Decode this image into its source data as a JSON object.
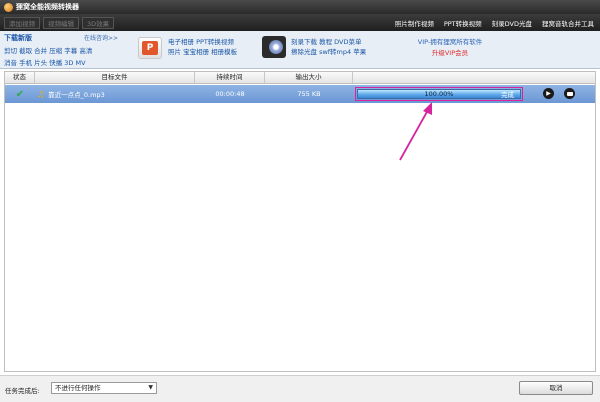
{
  "window": {
    "title": "狸窝全能视频转换器"
  },
  "toolbar": {
    "buttons": [
      "添加视频",
      "视频编辑",
      "3D效果"
    ],
    "links": [
      "照片制作视频",
      "PPT转换视频",
      "刻录DVD光盘",
      "狸窝音轨合并工具"
    ]
  },
  "banner": {
    "download_title": "下载新版",
    "online_help": "在线咨询>>",
    "download_rows": [
      "剪切 截取 合并 压缩 字幕 高清",
      "消音 手机 片头 快播 3D MV"
    ],
    "ad1_lines": [
      "电子相册 PPT转换视频",
      "照片 宝宝相册 相册模板"
    ],
    "ad2_lines": [
      "刻录下载 教程 DVD菜单",
      "擦除光盘 swf转mp4 苹果"
    ],
    "vip_title": "VIP-拥有狸窝所有软件",
    "vip_sub": "升级VIP会员"
  },
  "table": {
    "headers": [
      "状态",
      "目标文件",
      "持续时间",
      "输出大小"
    ],
    "rows": [
      {
        "file": "靠近一点点_0.mp3",
        "duration": "00:00:48",
        "size": "755 KB",
        "progress_text": "100.00%",
        "progress": 1.0,
        "status_text": "完成"
      }
    ]
  },
  "bottom": {
    "after_label": "任务完成后:",
    "after_value": "不进行任何操作",
    "cancel_label": "取消"
  },
  "colors": {
    "annotation": "#d6249f",
    "row_highlight": "#6b97d4"
  }
}
